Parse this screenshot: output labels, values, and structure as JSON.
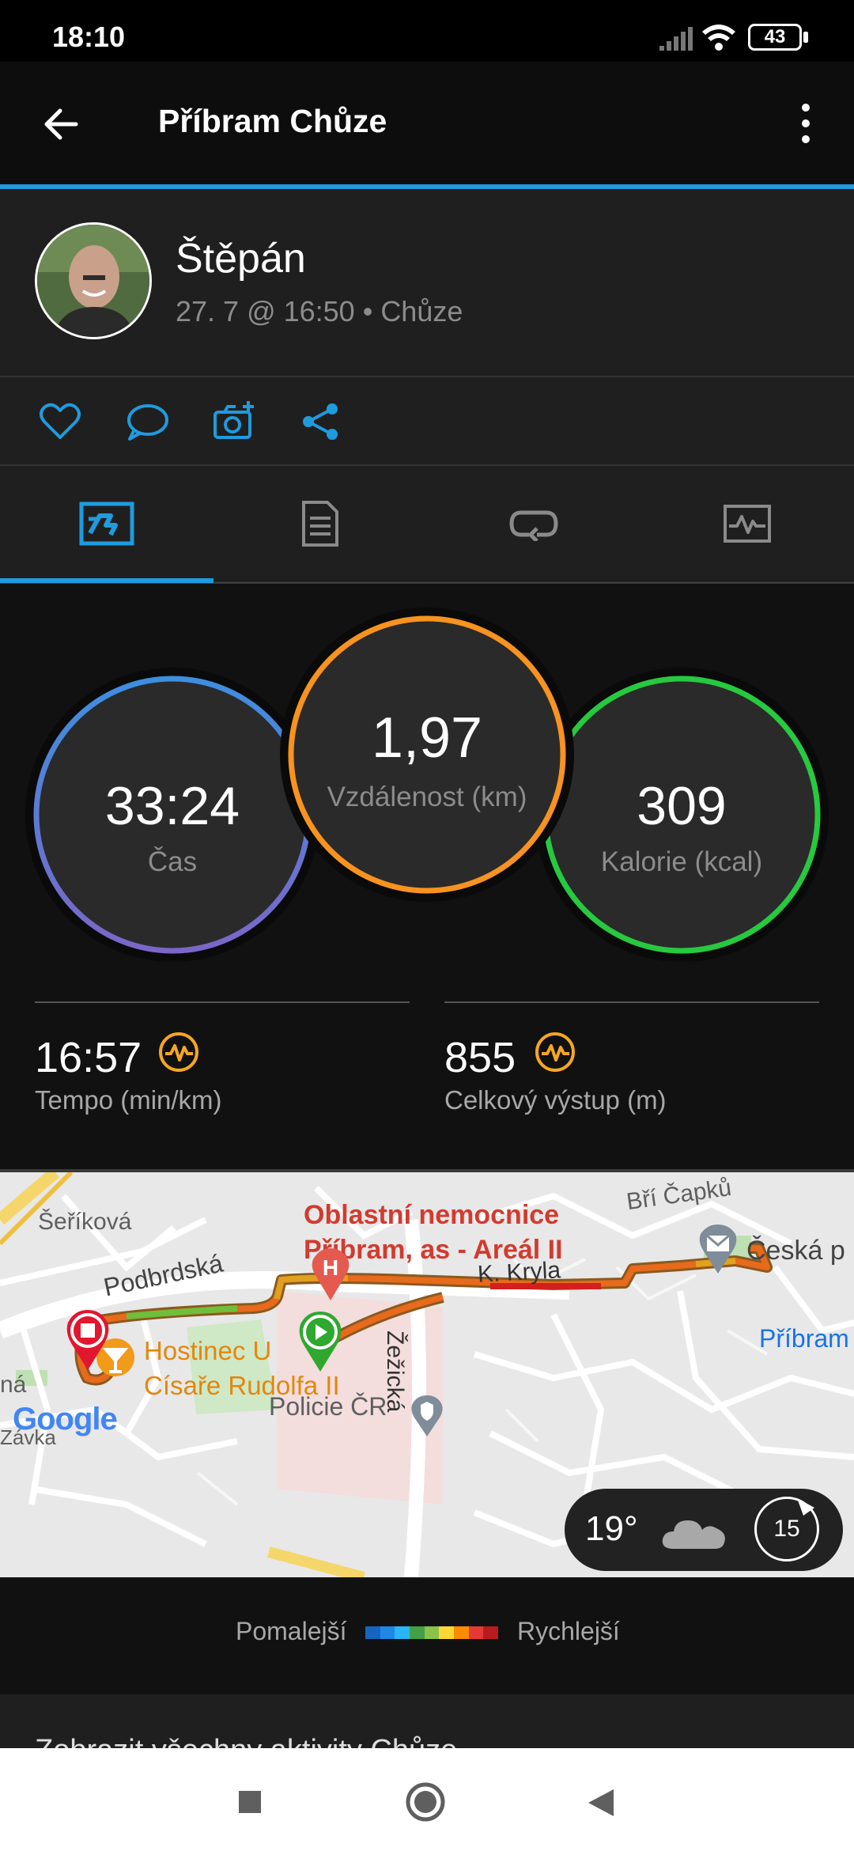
{
  "status": {
    "time": "18:10",
    "battery": "43"
  },
  "appbar": {
    "title": "Příbram Chůze"
  },
  "profile": {
    "name": "Štěpán",
    "meta": "27. 7 @ 16:50 • Chůze"
  },
  "stats": {
    "time": {
      "value": "33:24",
      "label": "Čas"
    },
    "distance": {
      "value": "1,97",
      "label": "Vzdálenost (km)"
    },
    "calories": {
      "value": "309",
      "label": "Kalorie (kcal)"
    },
    "pace": {
      "value": "16:57",
      "label": "Tempo (min/km)"
    },
    "ascent": {
      "value": "855",
      "label": "Celkový výstup (m)"
    }
  },
  "map": {
    "streets": [
      "Šeříková",
      "Podbrdská",
      "K. Kryla",
      "Žežická",
      "Bří Čapků",
      "Česká p",
      "Příbram",
      "ná",
      "Závka"
    ],
    "poi_hospital": [
      "Oblastní nemocnice",
      "Příbram, as - Areál II"
    ],
    "poi_restaurant": [
      "Hostinec U",
      "Císaře Rudolfa II"
    ],
    "poi_police": "Policie ČR",
    "google": "Google",
    "weather": {
      "temp": "19°",
      "wind": "15"
    }
  },
  "legend": {
    "slower": "Pomalejší",
    "faster": "Rychlejší",
    "colors": [
      "#1565c0",
      "#1e88e5",
      "#29b6f6",
      "#43a047",
      "#8bc34a",
      "#fdd835",
      "#fb8c00",
      "#e53935",
      "#b71c1c"
    ]
  },
  "more": {
    "label": "Zobrazit všechny aktivity Chůze"
  },
  "colors": {
    "accent": "#1f9bde",
    "time_ring": "#3d8fe0",
    "distance_ring": "#f7931e",
    "calories_ring": "#27c93f",
    "pace_icon": "#f5a623"
  }
}
